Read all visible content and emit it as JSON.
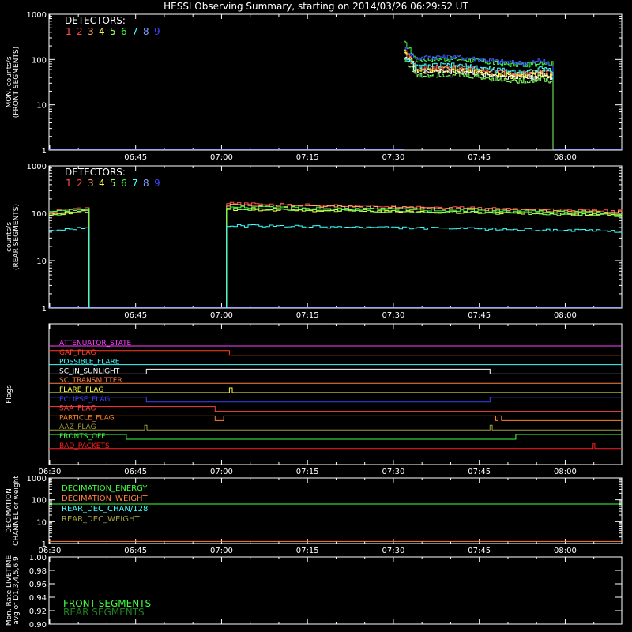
{
  "title": "HESSI Observing Summary, starting on 2014/03/26 06:29:52 UT",
  "time_ticks": [
    "06:30",
    "06:45",
    "07:00",
    "07:15",
    "07:30",
    "07:45",
    "08:00"
  ],
  "detector_colors": [
    "#ff5050",
    "#ff4040",
    "#ffb060",
    "#ffff40",
    "#a0ff60",
    "#40ff40",
    "#40ffff",
    "#80a0ff",
    "#4040ff"
  ],
  "chart_data": [
    {
      "type": "line",
      "id": "front",
      "ylabel": "MON. counts/s\n(FRONT SEGMENTS)",
      "ylog": true,
      "ylim": [
        1,
        1000
      ],
      "yticks": [
        "1",
        "10",
        "100",
        "1000"
      ],
      "legend_title": "DETECTORS:",
      "legend_entries": [
        "1",
        "2",
        "3",
        "4",
        "5",
        "6",
        "7",
        "8",
        "9"
      ],
      "xlim_minutes": [
        0,
        100
      ],
      "series": [
        {
          "color": "#40ff40",
          "start": 62,
          "end": 88,
          "v0": 230,
          "vm": 90,
          "v1": 80
        },
        {
          "color": "#4060ff",
          "start": 62,
          "end": 88,
          "v0": 180,
          "vm": 100,
          "v1": 70
        },
        {
          "color": "#ff5050",
          "start": 62,
          "end": 88,
          "v0": 160,
          "vm": 60,
          "v1": 50
        },
        {
          "color": "#ffb060",
          "start": 62,
          "end": 88,
          "v0": 140,
          "vm": 55,
          "v1": 45
        },
        {
          "color": "#ffff40",
          "start": 62,
          "end": 88,
          "v0": 150,
          "vm": 50,
          "v1": 40
        },
        {
          "color": "#ffffff",
          "start": 62,
          "end": 88,
          "v0": 120,
          "vm": 48,
          "v1": 38
        },
        {
          "color": "#40ffff",
          "start": 62,
          "end": 88,
          "v0": 110,
          "vm": 65,
          "v1": 55
        },
        {
          "color": "#80ff60",
          "start": 62,
          "end": 88,
          "v0": 100,
          "vm": 40,
          "v1": 30
        }
      ]
    },
    {
      "type": "line",
      "id": "rear",
      "ylabel": "counts/s\n(REAR SEGMENTS)",
      "ylog": true,
      "ylim": [
        1,
        1000
      ],
      "yticks": [
        "1",
        "10",
        "100",
        "1000"
      ],
      "legend_title": "DETECTORS:",
      "legend_entries": [
        "1",
        "2",
        "3",
        "4",
        "5",
        "6",
        "7",
        "8",
        "9"
      ],
      "xlim_minutes": [
        0,
        100
      ],
      "series": [
        {
          "color": "#ff5050",
          "segments": [
            [
              0,
              7,
              110,
              130
            ],
            [
              31,
              100,
              160,
              110
            ]
          ]
        },
        {
          "color": "#ffb060",
          "segments": [
            [
              0,
              7,
              100,
              120
            ],
            [
              31,
              100,
              150,
              105
            ]
          ]
        },
        {
          "color": "#ffff40",
          "segments": [
            [
              0,
              7,
              95,
              110
            ],
            [
              31,
              100,
              120,
              95
            ]
          ]
        },
        {
          "color": "#40ff40",
          "segments": [
            [
              0,
              7,
              105,
              125
            ],
            [
              31,
              100,
              135,
              100
            ]
          ]
        },
        {
          "color": "#80ff60",
          "segments": [
            [
              0,
              7,
              90,
              115
            ],
            [
              31,
              100,
              125,
              90
            ]
          ]
        },
        {
          "color": "#40ffff",
          "segments": [
            [
              0,
              7,
              42,
              50
            ],
            [
              31,
              100,
              55,
              42
            ]
          ]
        }
      ]
    },
    {
      "type": "flags",
      "id": "flags",
      "ylabel": "Flags",
      "xlim_minutes": [
        0,
        100
      ],
      "flags": [
        {
          "name": "ATTENUATOR_STATE",
          "color": "#ff40ff",
          "steps": []
        },
        {
          "name": "GAP_FLAG",
          "color": "#ff4020",
          "steps": [
            [
              0,
              31.5,
              1
            ],
            [
              31.5,
              100,
              0
            ]
          ]
        },
        {
          "name": "POSSIBLE_FLARE",
          "color": "#40ffff",
          "steps": []
        },
        {
          "name": "SC_IN_SUNLIGHT",
          "color": "#ffffff",
          "steps": [
            [
              0,
              17,
              0
            ],
            [
              17,
              77,
              1
            ],
            [
              77,
              100,
              0
            ]
          ]
        },
        {
          "name": "SC_TRANSMITTER",
          "color": "#ff8040",
          "steps": []
        },
        {
          "name": "FLARE_FLAG",
          "color": "#ffff40",
          "steps": [
            [
              0,
              31.5,
              0
            ],
            [
              31.5,
              32,
              1
            ],
            [
              32,
              100,
              0
            ]
          ]
        },
        {
          "name": "ECLIPSE_FLAG",
          "color": "#4040ff",
          "steps": [
            [
              0,
              17,
              1
            ],
            [
              17,
              77,
              0
            ],
            [
              77,
              100,
              1
            ]
          ]
        },
        {
          "name": "SAA_FLAG",
          "color": "#ff4040",
          "steps": [
            [
              0,
              29,
              1
            ],
            [
              29,
              100,
              0
            ]
          ]
        },
        {
          "name": "PARTICLE_FLAG",
          "color": "#ff8020",
          "steps": [
            [
              0,
              29,
              1
            ],
            [
              29,
              30.5,
              0
            ],
            [
              30.5,
              78,
              1
            ],
            [
              78,
              78.4,
              0
            ],
            [
              78.4,
              79,
              1
            ],
            [
              79,
              100,
              0
            ]
          ]
        },
        {
          "name": "AAZ_FLAG",
          "color": "#a0a040",
          "steps": [
            [
              0,
              16.7,
              0
            ],
            [
              16.7,
              17.1,
              1
            ],
            [
              17.1,
              77,
              0
            ],
            [
              77,
              77.4,
              1
            ],
            [
              77.4,
              100,
              0
            ]
          ]
        },
        {
          "name": "FRONTS_OFF",
          "color": "#40ff40",
          "steps": [
            [
              0,
              13.5,
              1
            ],
            [
              13.5,
              81.5,
              0
            ],
            [
              81.5,
              100,
              1
            ]
          ]
        },
        {
          "name": "BAD_PACKETS",
          "color": "#ff2020",
          "steps": [
            [
              0,
              95,
              0
            ],
            [
              95,
              95.3,
              1
            ],
            [
              95.3,
              100,
              0
            ]
          ]
        }
      ]
    },
    {
      "type": "line",
      "id": "decimation",
      "ylabel": "DECIMATION\nCHANNEL or weight",
      "ylog": true,
      "ylim": [
        1,
        1000
      ],
      "yticks": [
        "1",
        "10",
        "100",
        "1000"
      ],
      "xlim_minutes": [
        0,
        100
      ],
      "legend_entries": [
        {
          "name": "DECIMATION_ENERGY",
          "color": "#40ff40"
        },
        {
          "name": "DECIMATION_WEIGHT",
          "color": "#ff8040"
        },
        {
          "name": "REAR_DEC_CHAN/128",
          "color": "#40ffff"
        },
        {
          "name": "REAR_DEC_WEIGHT",
          "color": "#a0a040"
        }
      ],
      "series": [
        {
          "color": "#40ff40",
          "value": 64
        },
        {
          "color": "#ff8040",
          "value": 1.25
        }
      ]
    },
    {
      "type": "line",
      "id": "livetime",
      "ylabel": "Mon. Rate LIVETIME\navg of D1,3,4,5,6,9",
      "ylim": [
        0.9,
        1.0
      ],
      "yticks": [
        "0.90",
        "0.92",
        "0.94",
        "0.96",
        "0.98",
        "1.00"
      ],
      "xlim_minutes": [
        0,
        100
      ],
      "legend_entries": [
        {
          "name": "FRONT SEGMENTS",
          "color": "#40ff40"
        },
        {
          "name": "REAR SEGMENTS",
          "color": "#208020"
        }
      ],
      "series": []
    }
  ]
}
